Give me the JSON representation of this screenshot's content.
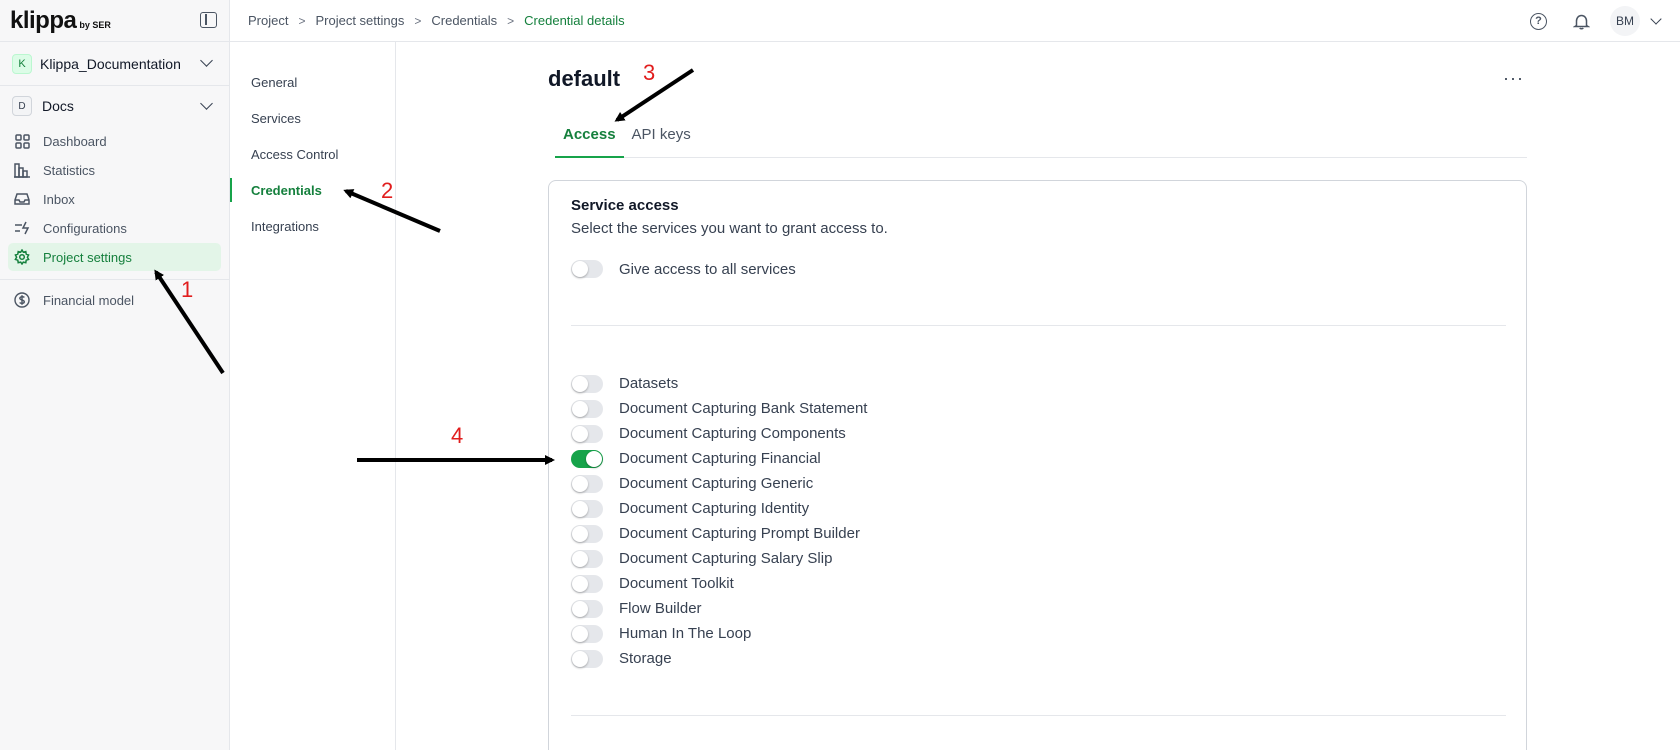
{
  "sidebar": {
    "logo": "klippa",
    "logo_sub": "by SER",
    "org": {
      "badge": "K",
      "name": "Klippa_Documentation"
    },
    "project": {
      "badge": "D",
      "name": "Docs"
    },
    "nav": [
      {
        "label": "Dashboard",
        "icon": "grid-icon"
      },
      {
        "label": "Statistics",
        "icon": "bar-chart-icon"
      },
      {
        "label": "Inbox",
        "icon": "inbox-icon"
      },
      {
        "label": "Configurations",
        "icon": "sliders-icon"
      },
      {
        "label": "Project settings",
        "icon": "gear-icon",
        "active": true
      }
    ],
    "extra": {
      "label": "Financial model",
      "icon": "dollar-icon"
    }
  },
  "header": {
    "breadcrumb": [
      "Project",
      "Project settings",
      "Credentials",
      "Credential details"
    ],
    "avatar": "BM"
  },
  "settings_nav": [
    "General",
    "Services",
    "Access Control",
    "Credentials",
    "Integrations"
  ],
  "main": {
    "title": "default",
    "more": "···",
    "tabs": [
      "Access",
      "API keys"
    ],
    "card": {
      "title": "Service access",
      "subtitle": "Select the services you want to grant access to.",
      "all_label": "Give access to all services",
      "services": [
        {
          "label": "Datasets",
          "on": false
        },
        {
          "label": "Document Capturing Bank Statement",
          "on": false
        },
        {
          "label": "Document Capturing Components",
          "on": false
        },
        {
          "label": "Document Capturing Financial",
          "on": true
        },
        {
          "label": "Document Capturing Generic",
          "on": false
        },
        {
          "label": "Document Capturing Identity",
          "on": false
        },
        {
          "label": "Document Capturing Prompt Builder",
          "on": false
        },
        {
          "label": "Document Capturing Salary Slip",
          "on": false
        },
        {
          "label": "Document Toolkit",
          "on": false
        },
        {
          "label": "Flow Builder",
          "on": false
        },
        {
          "label": "Human In The Loop",
          "on": false
        },
        {
          "label": "Storage",
          "on": false
        }
      ]
    }
  },
  "annotations": [
    "1",
    "2",
    "3",
    "4"
  ],
  "colors": {
    "accent": "#16a34a",
    "accent_text": "#15803d",
    "annotation": "#e11d1d"
  }
}
